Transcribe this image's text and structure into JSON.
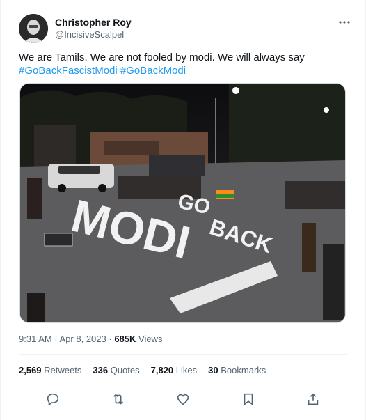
{
  "author": {
    "name": "Christopher Roy",
    "handle": "@IncisiveScalpel"
  },
  "tweet": {
    "text": "We are Tamils. We are not fooled by modi. We will always say",
    "hashtags": [
      "#GoBackFascistModi",
      "#GoBackModi"
    ]
  },
  "photo": {
    "road_text": [
      "GO",
      "BACK",
      "MODI"
    ]
  },
  "meta": {
    "time_date": "9:31 AM · Apr 8, 2023 · ",
    "views_count": "685K",
    "views_label": " Views"
  },
  "stats": {
    "retweets_count": "2,569",
    "retweets_label": "Retweets",
    "quotes_count": "336",
    "quotes_label": "Quotes",
    "likes_count": "7,820",
    "likes_label": "Likes",
    "bookmarks_count": "30",
    "bookmarks_label": "Bookmarks"
  },
  "icons": [
    "more-icon",
    "reply-icon",
    "retweet-icon",
    "like-icon",
    "bookmark-icon",
    "share-icon"
  ],
  "colors": {
    "link": "#1d9bf0",
    "secondary": "#536471",
    "primary": "#0f1419"
  }
}
